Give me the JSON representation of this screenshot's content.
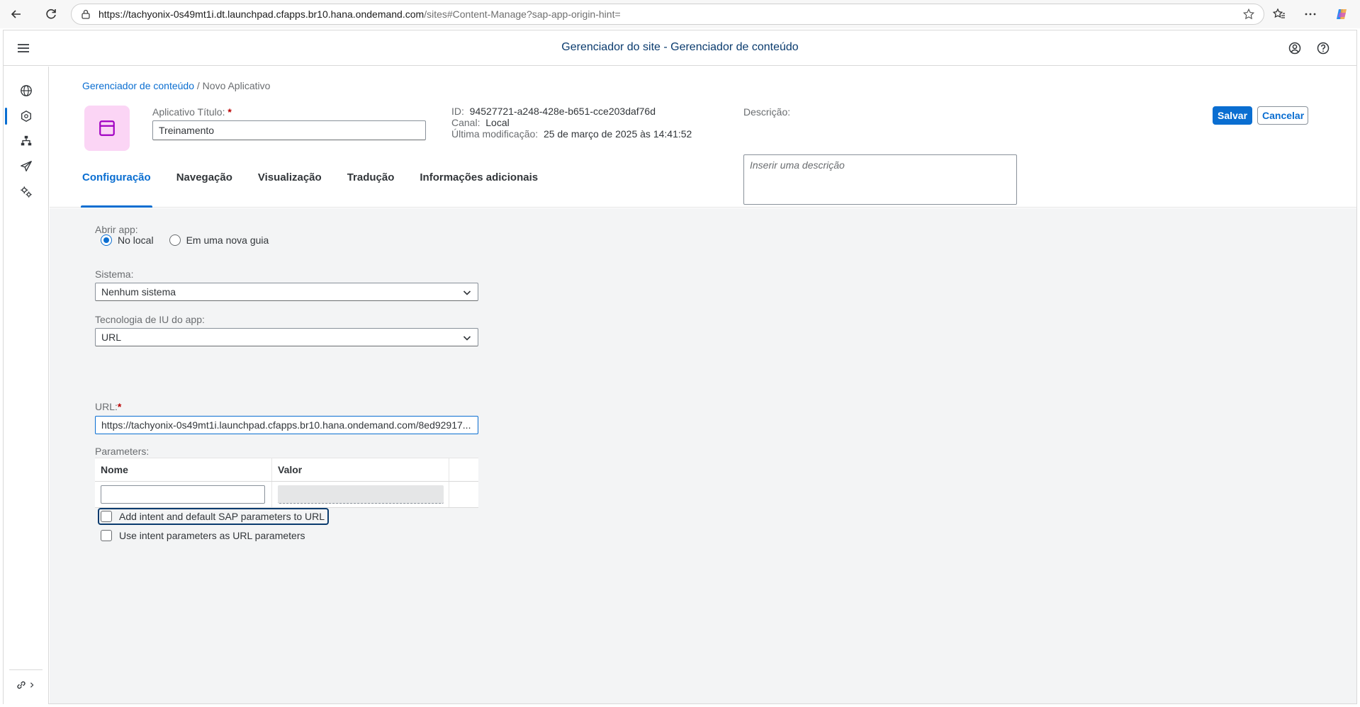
{
  "browser": {
    "url_host": "https://tachyonix-0s49mt1i.dt.launchpad.cfapps.br10.hana.ondemand.com",
    "url_path": "/sites#Content-Manage?sap-app-origin-hint="
  },
  "shell": {
    "title": "Gerenciador do site - Gerenciador de conteúdo"
  },
  "breadcrumb": {
    "link": "Gerenciador de conteúdo",
    "separator": "/",
    "current": "Novo Aplicativo"
  },
  "header": {
    "title_label": "Aplicativo Título:",
    "required_mark": "*",
    "title_value": "Treinamento",
    "id_label": "ID:",
    "id_value": "94527721-a248-428e-b651-cce203daf76d",
    "channel_label": "Canal:",
    "channel_value": "Local",
    "modified_label": "Última modificação:",
    "modified_value": "25 de março de 2025 às 14:41:52",
    "description_label": "Descrição:",
    "description_placeholder": "Inserir uma descrição",
    "save_label": "Salvar",
    "cancel_label": "Cancelar"
  },
  "tabs": [
    {
      "label": "Configuração",
      "active": true
    },
    {
      "label": "Navegação"
    },
    {
      "label": "Visualização"
    },
    {
      "label": "Tradução"
    },
    {
      "label": "Informações adicionais"
    }
  ],
  "config": {
    "open_app_label": "Abrir app:",
    "radio_local": "No local",
    "radio_new_tab": "Em uma nova guia",
    "system_label": "Sistema:",
    "system_value": "Nenhum sistema",
    "ui_tech_label": "Tecnologia de IU do app:",
    "ui_tech_value": "URL",
    "url_label": "URL:",
    "url_value": "https://tachyonix-0s49mt1i.launchpad.cfapps.br10.hana.ondemand.com/8ed92917...",
    "parameters_label": "Parameters:",
    "col_name": "Nome",
    "col_value": "Valor",
    "chk_intent_default": "Add intent and default SAP parameters to URL",
    "chk_intent_url": "Use intent parameters as URL parameters"
  },
  "colors": {
    "accent": "#0a6ed1",
    "shell_title": "#0a3b6e",
    "app_icon_bg": "#fbd5f5",
    "app_icon_fg": "#a100c2"
  },
  "icons": {
    "sidenav": [
      "globe-icon",
      "cube-icon",
      "sitemap-icon",
      "paper-plane-icon",
      "gears-icon"
    ],
    "bottom": "link-icon"
  }
}
